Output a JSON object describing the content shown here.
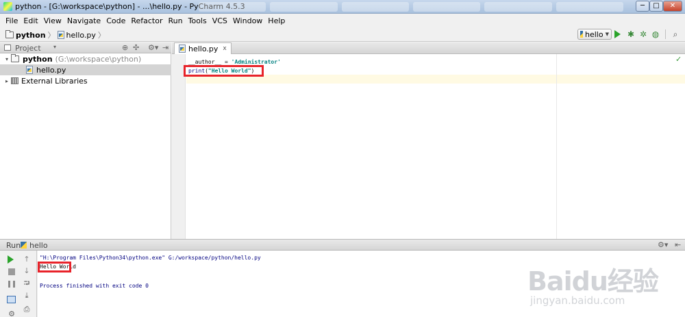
{
  "window": {
    "title": "python - [G:\\workspace\\python] - ...\\hello.py - PyCharm 4.5.3",
    "min_label": "─",
    "max_label": "□",
    "close_label": "✕"
  },
  "menu": [
    "File",
    "Edit",
    "View",
    "Navigate",
    "Code",
    "Refactor",
    "Run",
    "Tools",
    "VCS",
    "Window",
    "Help"
  ],
  "breadcrumb": {
    "project": "python",
    "file": "hello.py",
    "separator": "〉"
  },
  "toolbar": {
    "run_config": "hello",
    "debug_glyph": "✱",
    "coverage_glyph": "✲",
    "profile_glyph": "◍",
    "search_glyph": "⌕"
  },
  "project_panel": {
    "title": "Project",
    "caret": "▾",
    "header_glyphs": [
      "⊕",
      "✣",
      "⚙▾",
      "⇥"
    ],
    "tree": [
      {
        "arrow": "▾",
        "name": "python",
        "hint": "(G:\\workspace\\python)"
      },
      {
        "name": "hello.py"
      },
      {
        "arrow": "▸",
        "name": "External Libraries"
      }
    ]
  },
  "editor": {
    "tab_name": "hello.py",
    "tab_close": "x",
    "lines": [
      {
        "name": "__author__",
        "op": " = ",
        "str": "'Administrator'"
      },
      {
        "fn": "print",
        "open": "(",
        "str": "\"Hello World\"",
        "close": ")"
      }
    ],
    "status_glyph": "✓"
  },
  "run_panel": {
    "label": "Run",
    "config": "hello",
    "header_glyphs": [
      "⚙▾",
      "⇤"
    ],
    "toolbar_glyphs": {
      "gear": "⚙",
      "up": "↑",
      "down": "↓",
      "wrap": "⮒",
      "scroll": "⤓",
      "print": "⎙"
    },
    "console": [
      "\"H:\\Program Files\\Python34\\python.exe\" G:/workspace/python/hello.py",
      "Hello World",
      "",
      "Process finished with exit code 0"
    ]
  },
  "watermark": {
    "brand": "Baidu经验",
    "site": "jingyan.baidu.com"
  },
  "colors": {
    "highlight": "#e8232a",
    "string": "#008080",
    "builtin": "#000080",
    "run_green": "#2aa32a"
  }
}
